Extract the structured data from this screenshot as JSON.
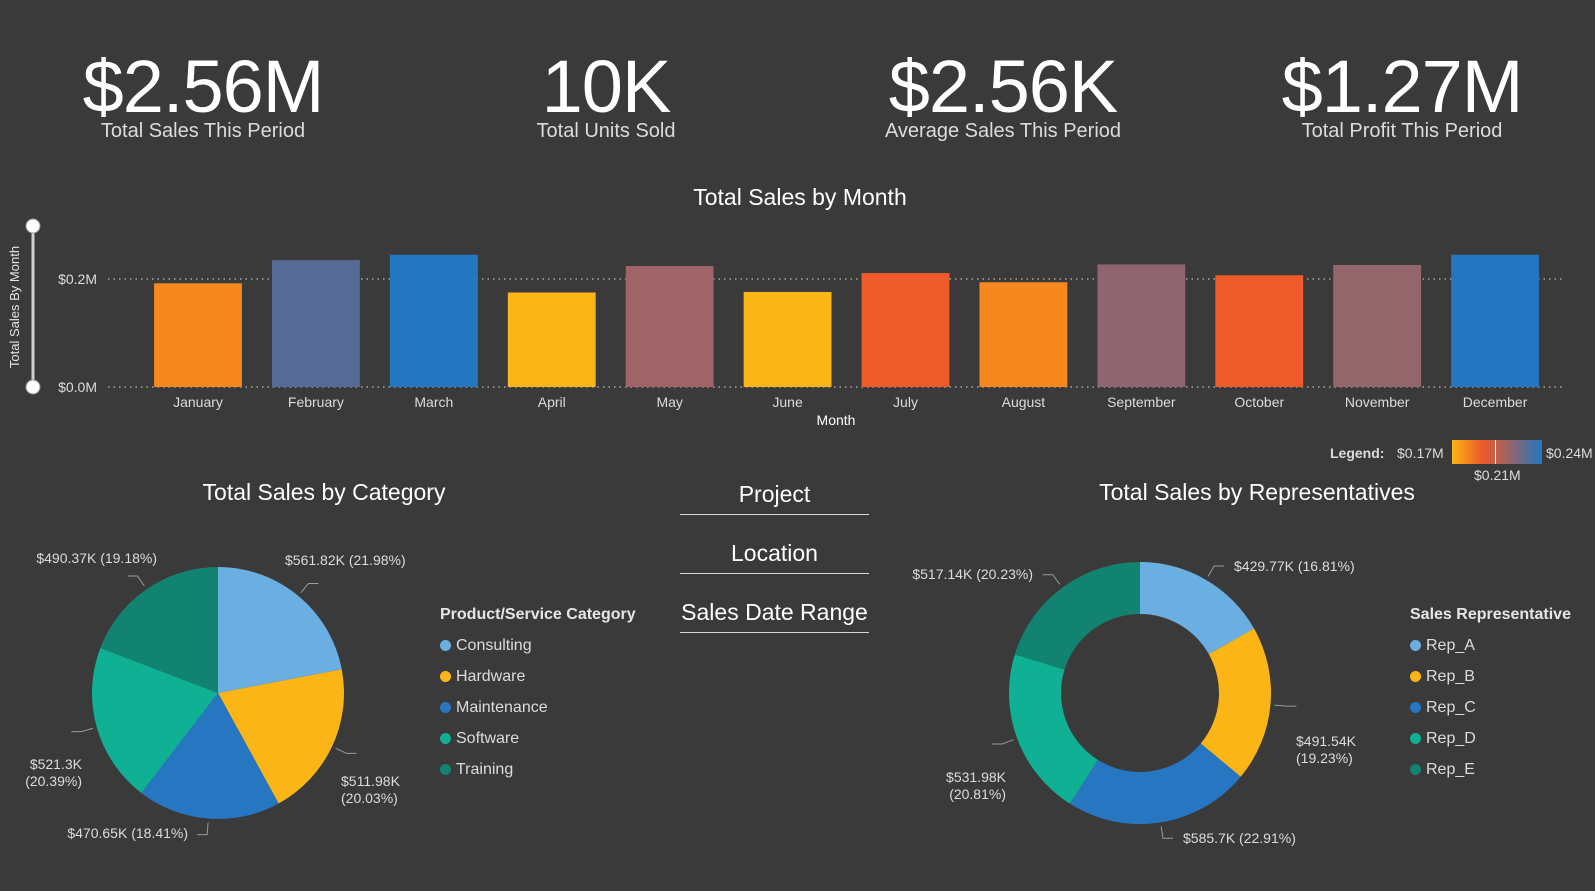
{
  "kpis": [
    {
      "value": "$2.56M",
      "label": "Total Sales This Period"
    },
    {
      "value": "10K",
      "label": "Total Units Sold"
    },
    {
      "value": "$2.56K",
      "label": "Average Sales This Period"
    },
    {
      "value": "$1.27M",
      "label": "Total Profit This Period"
    }
  ],
  "slicers": {
    "project": "Project",
    "location": "Location",
    "date_range": "Sales Date Range"
  },
  "colors": {
    "background": "#3a3a3a",
    "consulting": "#6aaee2",
    "hardware": "#fbb516",
    "maintenance": "#2776c2",
    "software": "#10b094",
    "training": "#128370"
  },
  "chart_data": [
    {
      "type": "bar",
      "title": "Total Sales by Month",
      "xlabel": "Month",
      "ylabel": "Total Sales By Month",
      "categories": [
        "January",
        "February",
        "March",
        "April",
        "May",
        "June",
        "July",
        "August",
        "September",
        "October",
        "November",
        "December"
      ],
      "values": [
        0.192,
        0.235,
        0.245,
        0.175,
        0.224,
        0.176,
        0.211,
        0.194,
        0.227,
        0.207,
        0.226,
        0.245
      ],
      "value_unit": "$M",
      "bar_colors": [
        "#f5891f",
        "#566a96",
        "#2476c1",
        "#fbb516",
        "#a06468",
        "#fbb516",
        "#ee5a29",
        "#f5891f",
        "#8f6670",
        "#ee5a29",
        "#93666c",
        "#2476c1"
      ],
      "yticks": [
        "$0.0M",
        "$0.2M"
      ],
      "ytick_values": [
        0,
        0.2
      ],
      "ylim": [
        0,
        0.3
      ],
      "grid": true,
      "legend": {
        "label": "Legend:",
        "min": "$0.17M",
        "mid": "$0.21M",
        "max": "$0.24M"
      }
    },
    {
      "type": "pie",
      "title": "Total Sales by Category",
      "legend_title": "Product/Service Category",
      "legend_position": "right",
      "slices": [
        {
          "name": "Consulting",
          "value": 561.82,
          "label": "$561.82K (21.98%)",
          "color": "#6aaee2"
        },
        {
          "name": "Hardware",
          "value": 511.98,
          "label": "$511.98K (20.03%)",
          "color": "#fbb516"
        },
        {
          "name": "Maintenance",
          "value": 470.65,
          "label": "$470.65K (18.41%)",
          "color": "#2776c2"
        },
        {
          "name": "Software",
          "value": 521.3,
          "label": "$521.3K (20.39%)",
          "color": "#10b094"
        },
        {
          "name": "Training",
          "value": 490.37,
          "label": "$490.37K (19.18%)",
          "color": "#128370"
        }
      ]
    },
    {
      "type": "pie",
      "title": "Total Sales by Representatives",
      "legend_title": "Sales Representative",
      "legend_position": "right",
      "donut": true,
      "slices": [
        {
          "name": "Rep_A",
          "value": 429.77,
          "label": "$429.77K (16.81%)",
          "color": "#6aaee2"
        },
        {
          "name": "Rep_B",
          "value": 491.54,
          "label": "$491.54K (19.23%)",
          "color": "#fbb516"
        },
        {
          "name": "Rep_C",
          "value": 585.7,
          "label": "$585.7K (22.91%)",
          "color": "#2776c2"
        },
        {
          "name": "Rep_D",
          "value": 531.98,
          "label": "$531.98K (20.81%)",
          "color": "#10b094"
        },
        {
          "name": "Rep_E",
          "value": 517.14,
          "label": "$517.14K (20.23%)",
          "color": "#128370"
        }
      ]
    }
  ]
}
